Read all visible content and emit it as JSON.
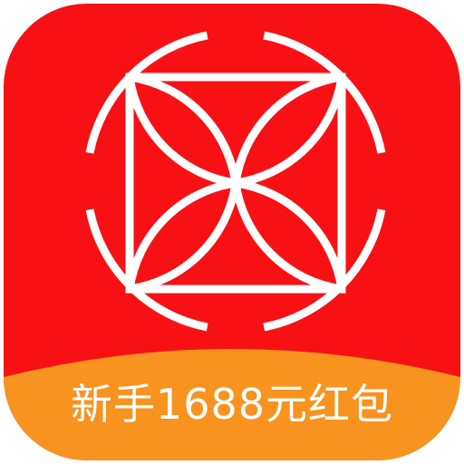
{
  "app_icon": {
    "name": "red-envelope-app-icon",
    "background_color": "#f71114",
    "band_color": "#f7931e",
    "mark_color": "#ffffff",
    "logo": "coin-lattice-logo-icon",
    "promo_text": "新手1688元红包"
  }
}
